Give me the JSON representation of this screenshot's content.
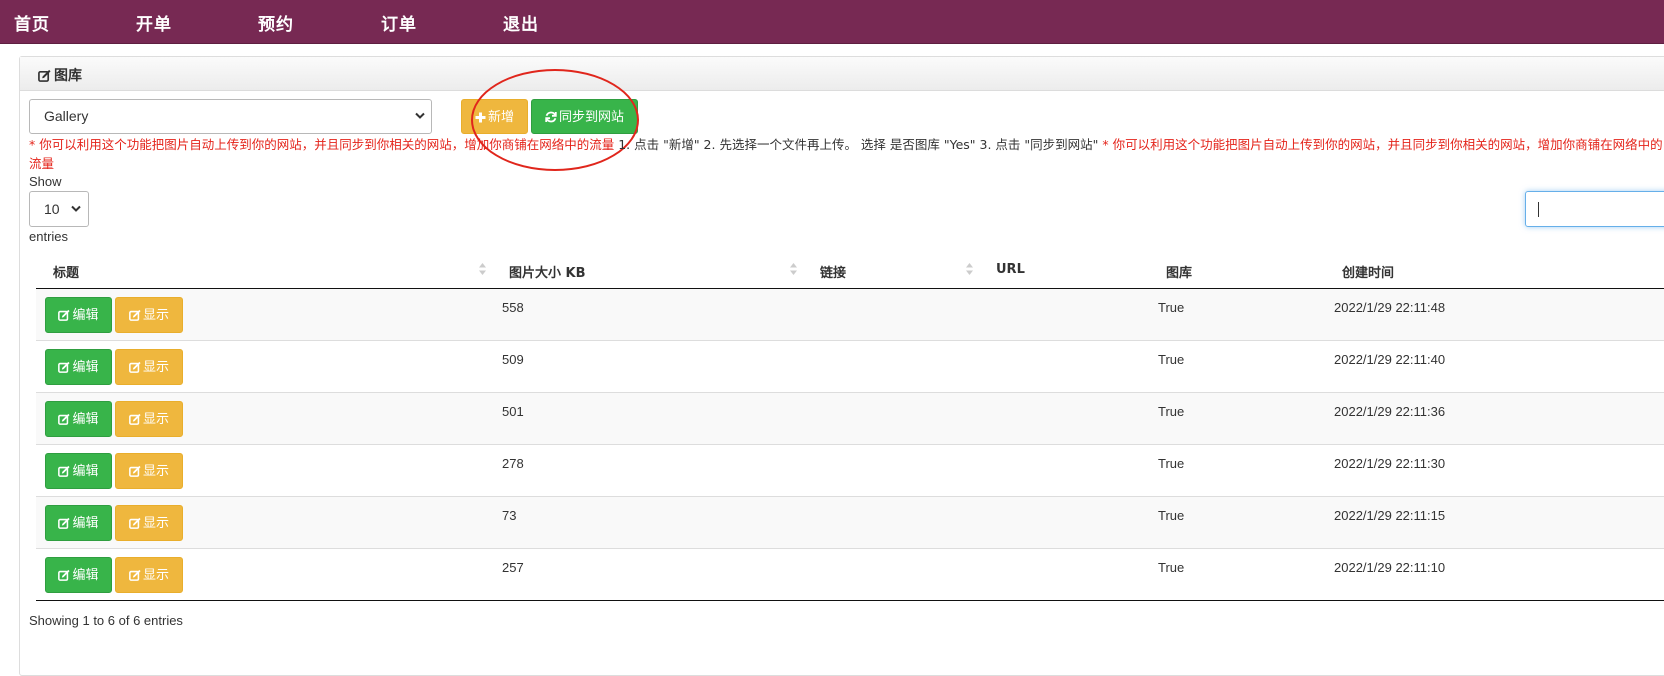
{
  "nav": {
    "items": [
      "首页",
      "开单",
      "预约",
      "订单",
      "退出"
    ]
  },
  "panel": {
    "title": "图库"
  },
  "toolbar": {
    "gallery_selected": "Gallery",
    "add_label": "新增",
    "sync_label": "同步到网站"
  },
  "hint": {
    "red_text_1": "* 你可以利用这个功能把图片自动上传到你的网站，并且同步到你相关的网站，增加你商铺在网络中的流量",
    "black_text": " 1. 点击 \"新增\" 2. 先选择一个文件再上传。 选择 是否图库 \"Yes\" 3. 点击 \"同步到网站\" ",
    "red_text_2": "* 你可以利用这个功能把图片自动上传到你的网站，并且同步到你相关的网站，增加你商铺在网络中的流量"
  },
  "datatable": {
    "show_label": "Show",
    "page_length": "10",
    "entries_label": "entries",
    "search_value": "",
    "info": "Showing 1 to 6 of 6 entries"
  },
  "table": {
    "columns": [
      "标题",
      "图片大小 KB",
      "链接",
      "URL",
      "图库",
      "创建时间"
    ],
    "edit_label": "编辑",
    "show_label": "显示",
    "rows": [
      {
        "size": "558",
        "link": "",
        "url": "",
        "gallery": "True",
        "created": "2022/1/29 22:11:48"
      },
      {
        "size": "509",
        "link": "",
        "url": "",
        "gallery": "True",
        "created": "2022/1/29 22:11:40"
      },
      {
        "size": "501",
        "link": "",
        "url": "",
        "gallery": "True",
        "created": "2022/1/29 22:11:36"
      },
      {
        "size": "278",
        "link": "",
        "url": "",
        "gallery": "True",
        "created": "2022/1/29 22:11:30"
      },
      {
        "size": "73",
        "link": "",
        "url": "",
        "gallery": "True",
        "created": "2022/1/29 22:11:15"
      },
      {
        "size": "257",
        "link": "",
        "url": "",
        "gallery": "True",
        "created": "2022/1/29 22:11:10"
      }
    ]
  },
  "colors": {
    "navbar": "#772953",
    "success": "#38b44a",
    "warning": "#efb73e",
    "hint_red": "#e4231a",
    "annotation": "#e0261c"
  },
  "icons": [
    "edit-icon",
    "plus-icon",
    "refresh-icon",
    "sort-icon",
    "chevron-down-icon"
  ]
}
